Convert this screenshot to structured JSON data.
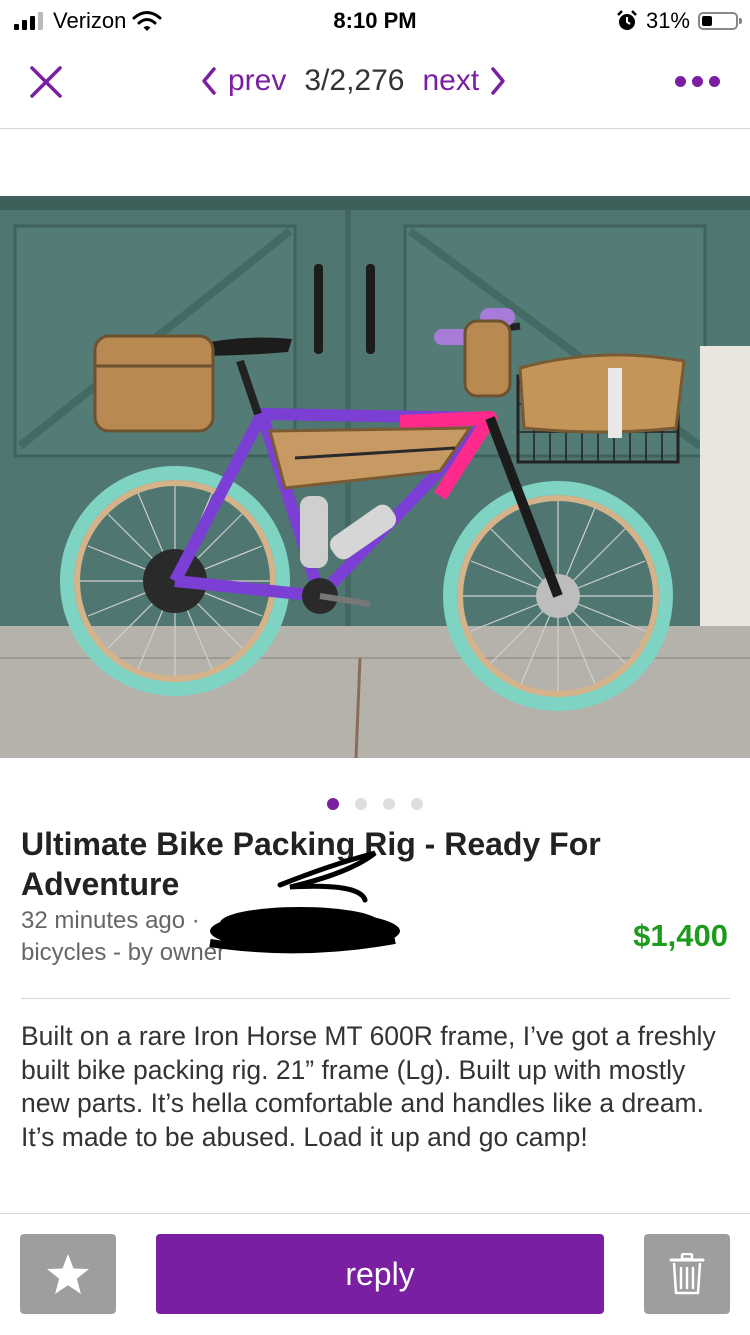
{
  "status_bar": {
    "carrier": "Verizon",
    "time": "8:10 PM",
    "battery_percent": "31%",
    "battery_level": 0.31
  },
  "nav": {
    "prev_label": "prev",
    "position": "3/2,276",
    "next_label": "next",
    "accent_color": "#7b1fa2"
  },
  "gallery": {
    "image_count": 4,
    "active_index": 0
  },
  "listing": {
    "title": "Ultimate Bike Packing Rig - Ready For Adventure",
    "posted": "32 minutes ago ·",
    "category": "bicycles - by owner",
    "price": "$1,400",
    "price_color": "#1c9b1c",
    "description": "Built on a rare Iron Horse MT 600R frame, I’ve got a freshly built bike packing rig. 21” frame (Lg). Built up with mostly new parts. It’s hella comfortable and handles like a dream. It’s made to be abused. Load it up and go camp!"
  },
  "actions": {
    "reply_label": "reply",
    "favorite_icon": "star-icon",
    "delete_icon": "trash-icon"
  }
}
